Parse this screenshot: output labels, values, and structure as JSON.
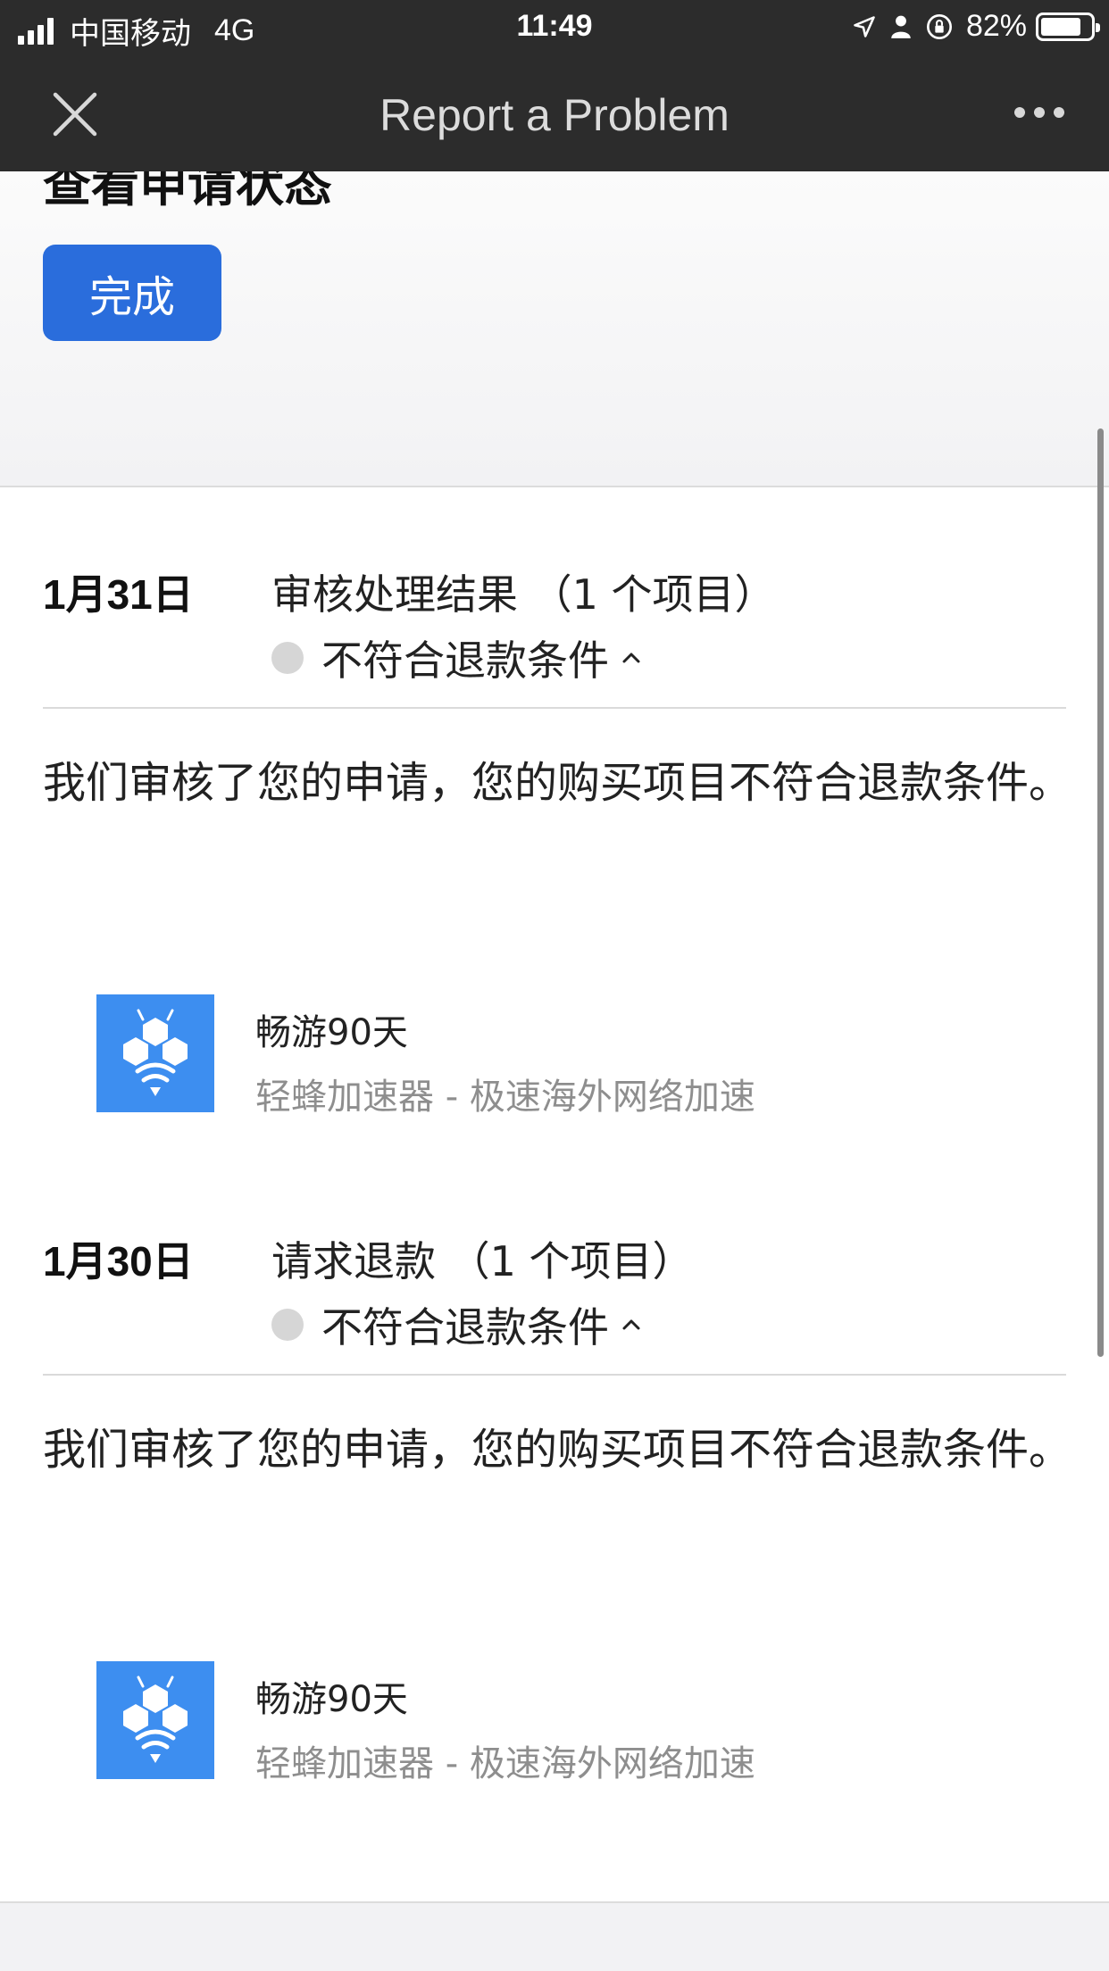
{
  "status_bar": {
    "carrier": "中国移动",
    "network": "4G",
    "time": "11:49",
    "battery": "82%",
    "battery_level": 0.82
  },
  "nav": {
    "title": "Report a Problem"
  },
  "top": {
    "title": "查看申请状态",
    "done_label": "完成"
  },
  "colors": {
    "accent": "#2a6ddc",
    "app_icon": "#3d8ef0",
    "nav_bg": "#2c2c2c"
  },
  "entries": [
    {
      "date": "1月31日",
      "heading": "审核处理结果 （1 个项目）",
      "status": "不符合退款条件",
      "message": "我们审核了您的申请，您的购买项目不符合退款条件。",
      "item": {
        "icon": "bee-app-icon",
        "name": "畅游90天",
        "subtitle": "轻蜂加速器 - 极速海外网络加速"
      }
    },
    {
      "date": "1月30日",
      "heading": "请求退款 （1 个项目）",
      "status": "不符合退款条件",
      "message": "我们审核了您的申请，您的购买项目不符合退款条件。",
      "item": {
        "icon": "bee-app-icon",
        "name": "畅游90天",
        "subtitle": "轻蜂加速器 - 极速海外网络加速"
      }
    }
  ]
}
